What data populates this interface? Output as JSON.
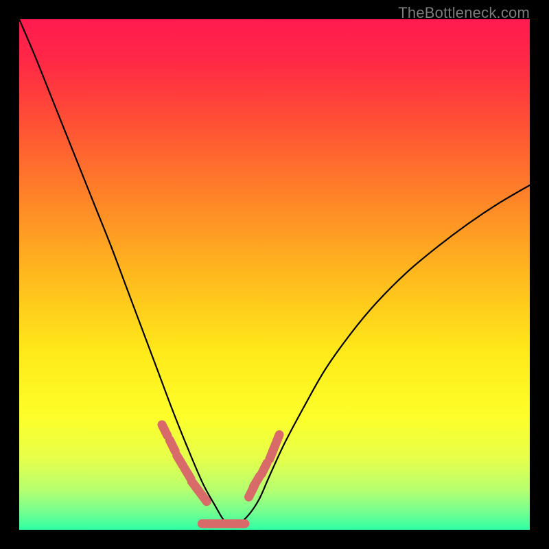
{
  "watermark": "TheBottleneck.com",
  "colors": {
    "background": "#000000",
    "gradient_stops": [
      {
        "offset": 0.0,
        "color": "#ff1a4f"
      },
      {
        "offset": 0.08,
        "color": "#ff2846"
      },
      {
        "offset": 0.2,
        "color": "#ff4f35"
      },
      {
        "offset": 0.35,
        "color": "#ff8428"
      },
      {
        "offset": 0.5,
        "color": "#ffb91e"
      },
      {
        "offset": 0.65,
        "color": "#ffe91a"
      },
      {
        "offset": 0.78,
        "color": "#fdff2a"
      },
      {
        "offset": 0.86,
        "color": "#e6ff4a"
      },
      {
        "offset": 0.92,
        "color": "#b8ff6e"
      },
      {
        "offset": 0.96,
        "color": "#7dff8d"
      },
      {
        "offset": 1.0,
        "color": "#2fffa3"
      }
    ],
    "curve": "#000000",
    "highlight": "#d86a6a"
  },
  "chart_data": {
    "type": "line",
    "title": "",
    "xlabel": "",
    "ylabel": "",
    "x": [
      0.0,
      0.03,
      0.06,
      0.09,
      0.12,
      0.15,
      0.18,
      0.21,
      0.24,
      0.27,
      0.3,
      0.33,
      0.36,
      0.385,
      0.4,
      0.415,
      0.43,
      0.45,
      0.47,
      0.49,
      0.52,
      0.56,
      0.6,
      0.65,
      0.7,
      0.76,
      0.82,
      0.88,
      0.94,
      1.0
    ],
    "values": [
      1.0,
      0.93,
      0.855,
      0.78,
      0.705,
      0.63,
      0.555,
      0.475,
      0.395,
      0.315,
      0.235,
      0.16,
      0.09,
      0.045,
      0.02,
      0.01,
      0.012,
      0.03,
      0.06,
      0.105,
      0.17,
      0.245,
      0.315,
      0.385,
      0.445,
      0.505,
      0.555,
      0.6,
      0.64,
      0.675
    ],
    "xlim": [
      0,
      1
    ],
    "ylim": [
      0,
      1
    ],
    "highlight_segments": [
      {
        "x": [
          0.285,
          0.3,
          0.315,
          0.33,
          0.345,
          0.36
        ],
        "y": [
          0.195,
          0.165,
          0.135,
          0.11,
          0.085,
          0.065
        ]
      },
      {
        "x": [
          0.455,
          0.465,
          0.48,
          0.495,
          0.505
        ],
        "y": [
          0.075,
          0.095,
          0.12,
          0.15,
          0.175
        ]
      }
    ],
    "legend": [],
    "grid": false
  }
}
